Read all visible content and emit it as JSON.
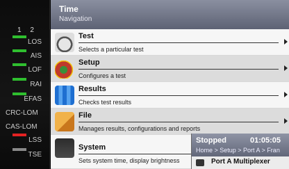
{
  "left_panel": {
    "port_numbers": [
      "1",
      "2"
    ],
    "indicators": [
      {
        "label": "LOS",
        "color": "#2fbf2f"
      },
      {
        "label": "AIS",
        "color": "#2fbf2f"
      },
      {
        "label": "LOF",
        "color": "#2fbf2f"
      },
      {
        "label": "RAI",
        "color": "#2fbf2f"
      },
      {
        "label": "EFAS",
        "color": "#2fbf2f"
      },
      {
        "label": "CRC-LOM",
        "color": ""
      },
      {
        "label": "CAS-LOM",
        "color": ""
      },
      {
        "label": "LSS",
        "color": "#e32222"
      },
      {
        "label": "TSE",
        "color": "#8a8a8a"
      }
    ]
  },
  "header": {
    "title": "Time",
    "subtitle": "Navigation"
  },
  "menu": [
    {
      "name": "Test",
      "desc": "Selects a particular test",
      "icon": "speedometer-icon"
    },
    {
      "name": "Setup",
      "desc": "Configures a test",
      "icon": "setup-gears-icon"
    },
    {
      "name": "Results",
      "desc": "Checks test results",
      "icon": "results-chart-icon"
    },
    {
      "name": "File",
      "desc": "Manages results, configurations and reports",
      "icon": "folder-icon"
    },
    {
      "name": "System",
      "desc": "Sets system time, display brightness",
      "icon": "system-icon"
    }
  ],
  "popup": {
    "state": "Stopped",
    "time": "01:05:05",
    "breadcrumb": "Home > Setup > Port A > Fran",
    "title": "Port A Multiplexer"
  }
}
